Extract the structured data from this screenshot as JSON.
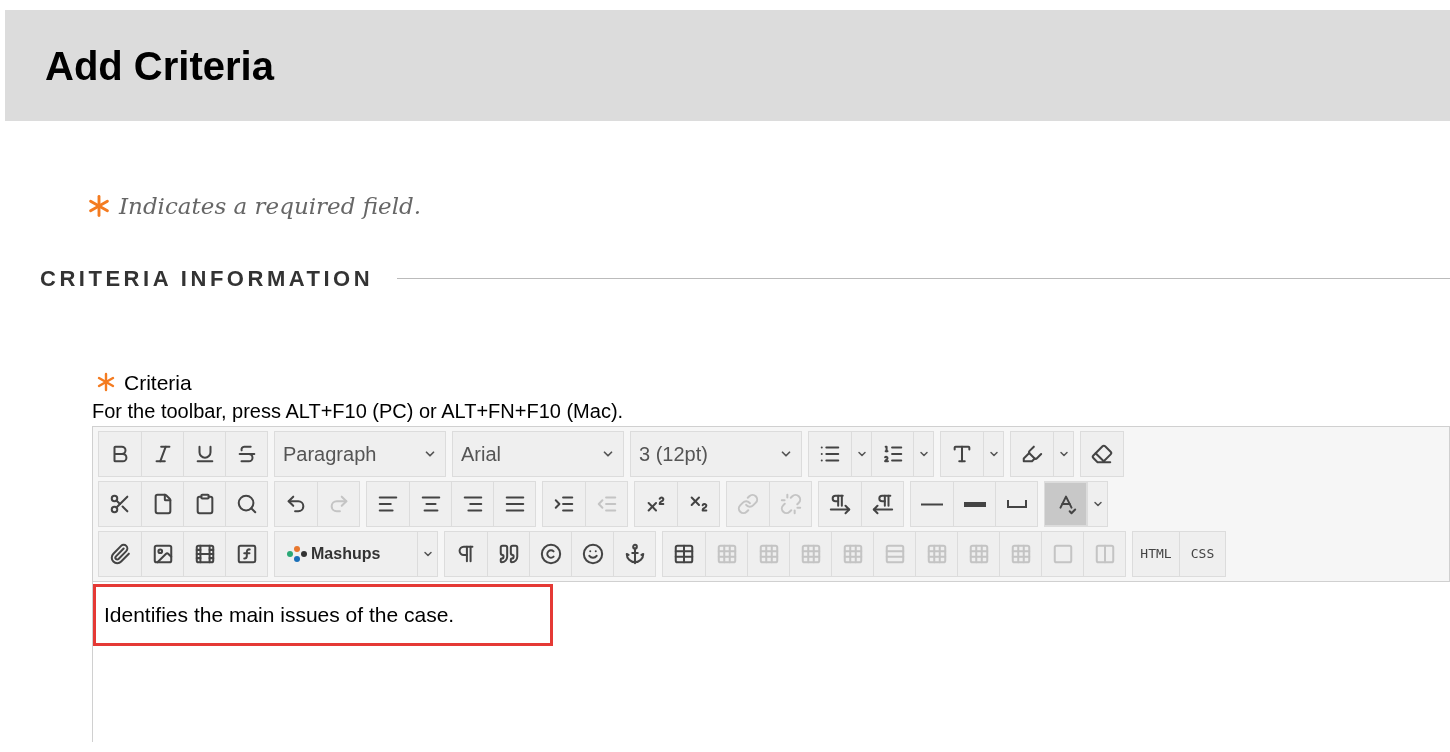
{
  "page_title": "Add Criteria",
  "required_note": "Indicates a required field.",
  "section_heading": "CRITERIA INFORMATION",
  "field": {
    "label": "Criteria",
    "required": true,
    "help": "For the toolbar, press ALT+F10 (PC) or ALT+FN+F10 (Mac)."
  },
  "toolbar": {
    "rows": [
      [
        {
          "items": [
            {
              "kind": "icon",
              "disabled": false,
              "on": false
            },
            {
              "kind": "icon",
              "disabled": false,
              "on": false
            },
            {
              "kind": "icon",
              "disabled": false,
              "on": false
            },
            {
              "kind": "icon",
              "disabled": false,
              "on": false
            }
          ]
        },
        {
          "items": [
            {
              "kind": "select",
              "value": "Paragraph"
            }
          ]
        },
        {
          "items": [
            {
              "kind": "select",
              "value": "Arial"
            }
          ]
        },
        {
          "items": [
            {
              "kind": "select",
              "value": "3 (12pt)"
            }
          ]
        },
        {
          "items": [
            {
              "kind": "split",
              "disabled": false,
              "on": false
            },
            {
              "kind": "split",
              "disabled": false,
              "on": false
            }
          ]
        },
        {
          "items": [
            {
              "kind": "split",
              "disabled": false,
              "on": false
            }
          ]
        },
        {
          "items": [
            {
              "kind": "split",
              "disabled": false,
              "on": false
            }
          ]
        },
        {
          "items": [
            {
              "kind": "icon",
              "disabled": false,
              "on": false
            }
          ]
        }
      ],
      [
        {
          "items": [
            {
              "kind": "icon",
              "disabled": false,
              "on": false
            },
            {
              "kind": "icon",
              "disabled": false,
              "on": false
            },
            {
              "kind": "icon",
              "disabled": false,
              "on": false
            },
            {
              "kind": "icon",
              "disabled": false,
              "on": false
            }
          ]
        },
        {
          "items": [
            {
              "kind": "icon",
              "disabled": false,
              "on": false
            },
            {
              "kind": "icon",
              "disabled": true,
              "on": false
            }
          ]
        },
        {
          "items": [
            {
              "kind": "icon",
              "disabled": false,
              "on": false
            },
            {
              "kind": "icon",
              "disabled": false,
              "on": false
            },
            {
              "kind": "icon",
              "disabled": false,
              "on": false
            },
            {
              "kind": "icon",
              "disabled": false,
              "on": false
            }
          ]
        },
        {
          "items": [
            {
              "kind": "icon",
              "disabled": false,
              "on": false
            },
            {
              "kind": "icon",
              "disabled": true,
              "on": false
            }
          ]
        },
        {
          "items": [
            {
              "kind": "icon",
              "disabled": false,
              "on": false
            },
            {
              "kind": "icon",
              "disabled": false,
              "on": false
            }
          ]
        },
        {
          "items": [
            {
              "kind": "icon",
              "disabled": true,
              "on": false
            },
            {
              "kind": "icon",
              "disabled": true,
              "on": false
            }
          ]
        },
        {
          "items": [
            {
              "kind": "icon",
              "disabled": false,
              "on": false
            },
            {
              "kind": "icon",
              "disabled": false,
              "on": false
            }
          ]
        },
        {
          "items": [
            {
              "kind": "icon",
              "disabled": false,
              "on": false
            },
            {
              "kind": "icon",
              "disabled": false,
              "on": false
            },
            {
              "kind": "icon",
              "disabled": false,
              "on": false
            }
          ]
        },
        {
          "items": [
            {
              "kind": "split",
              "disabled": false,
              "on": true
            }
          ]
        }
      ],
      [
        {
          "items": [
            {
              "kind": "icon",
              "disabled": false,
              "on": false
            },
            {
              "kind": "icon",
              "disabled": false,
              "on": false
            },
            {
              "kind": "icon",
              "disabled": false,
              "on": false
            },
            {
              "kind": "icon",
              "disabled": false,
              "on": false
            }
          ]
        },
        {
          "items": [
            {
              "kind": "mashups",
              "label": "Mashups"
            }
          ]
        },
        {
          "items": [
            {
              "kind": "icon",
              "disabled": false,
              "on": false
            },
            {
              "kind": "icon",
              "disabled": false,
              "on": false
            },
            {
              "kind": "icon",
              "disabled": false,
              "on": false
            },
            {
              "kind": "icon",
              "disabled": false,
              "on": false
            },
            {
              "kind": "icon",
              "disabled": false,
              "on": false
            }
          ]
        },
        {
          "items": [
            {
              "kind": "icon",
              "disabled": false,
              "on": false
            },
            {
              "kind": "icon",
              "disabled": true,
              "on": false
            },
            {
              "kind": "icon",
              "disabled": true,
              "on": false
            },
            {
              "kind": "icon",
              "disabled": true,
              "on": false
            },
            {
              "kind": "icon",
              "disabled": true,
              "on": false
            },
            {
              "kind": "icon",
              "disabled": true,
              "on": false
            },
            {
              "kind": "icon",
              "disabled": true,
              "on": false
            },
            {
              "kind": "icon",
              "disabled": true,
              "on": false
            },
            {
              "kind": "icon",
              "disabled": true,
              "on": false
            },
            {
              "kind": "icon",
              "disabled": true,
              "on": false
            },
            {
              "kind": "icon",
              "disabled": true,
              "on": false
            }
          ]
        },
        {
          "items": [
            {
              "kind": "text",
              "label": "HTML"
            },
            {
              "kind": "text",
              "label": "CSS"
            }
          ]
        }
      ]
    ]
  },
  "editor": {
    "content": "Identifies the main issues of the case.",
    "highlighted": true
  }
}
